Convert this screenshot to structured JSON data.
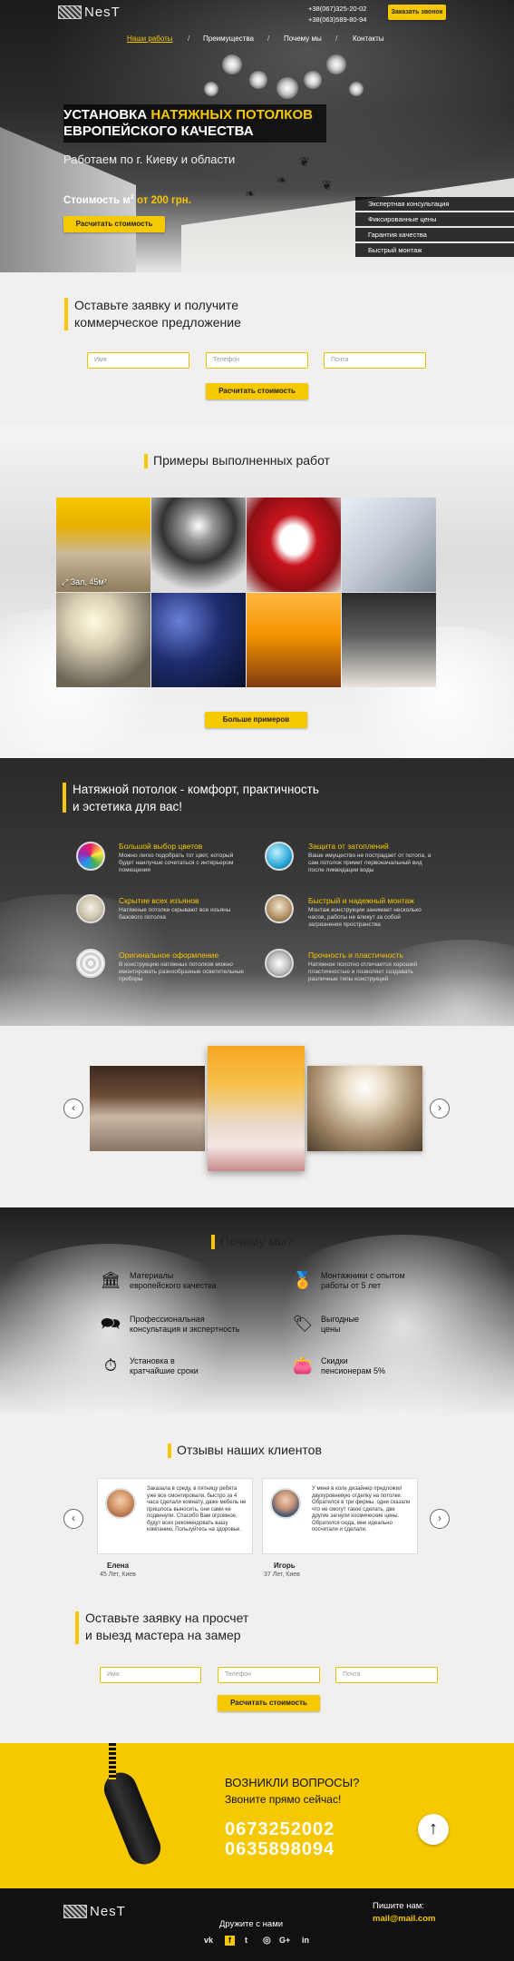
{
  "header": {
    "logo_text": "NesT",
    "phones": [
      "+38(067)325-20-02",
      "+38(063)589-80-94"
    ],
    "call_button": "Заказать звонок",
    "nav": [
      "Наши работы",
      "Преимущества",
      "Почему мы",
      "Контакты"
    ],
    "nav_separator": "/"
  },
  "hero": {
    "title_part1": "УСТАНОВКА ",
    "title_highlight": "НАТЯЖНЫХ ПОТОЛКОВ",
    "title_line2": "ЕВРОПЕЙСКОГО КАЧЕСТВА",
    "subtitle": "Работаем по г. Киеву и области",
    "price_label": "Стоимость м",
    "price_sup": "2",
    "price_value": " от 200 грн.",
    "cta_button": "Расчитать стоимость",
    "features": [
      "Экспертная консультация",
      "Фиксированные цены",
      "Гарантия качества",
      "Быстрый монтаж"
    ]
  },
  "request_form": {
    "heading_line1": "Оставьте заявку и получите",
    "heading_line2": "коммерческое предложение",
    "name_placeholder": "Имя",
    "phone_placeholder": "Телефон",
    "email_placeholder": "Почта",
    "submit": "Расчитать стоимость"
  },
  "works": {
    "heading": "Примеры выполненных работ",
    "first_photo_label": "Зал, 45м²",
    "more_button": "Больше примеров"
  },
  "comfort": {
    "heading_line1": "Натяжной потолок - комфорт, практичность",
    "heading_line2": "и эстетика для вас!",
    "items": [
      {
        "title": "Большой выбор цветов",
        "text": "Можно легко подобрать тот цвет, который будет наилучше сочетаться с интерьером помещения",
        "icon": "color-balls-icon"
      },
      {
        "title": "Защита от затоплений",
        "text": "Ваше имущество не пострадает от потопа, а сам потолок примет первоначальный вид после ликвидации воды",
        "icon": "water-drop-icon"
      },
      {
        "title": "Скрытие всех изъянов",
        "text": "Натяжные потолки скрывают все изъяны базового потолка",
        "icon": "ceiling-flaw-icon"
      },
      {
        "title": "Быстрый и надежный монтаж",
        "text": "Монтаж конструкции занимает несколько часов, работы не влекут за собой загрязнения пространства",
        "icon": "installation-icon"
      },
      {
        "title": "Оригинальное оформление",
        "text": "В конструкцию натяжных потолков можно вмонтировать разнообразные осветительные приборы",
        "icon": "texture-icon"
      },
      {
        "title": "Прочность и пластичность",
        "text": "Натяжное полотно отличается хорошей пластичностью и позволяет создавать различные типы конструкций",
        "icon": "ceiling-structure-icon"
      }
    ]
  },
  "slider": {
    "prev": "‹",
    "next": "›"
  },
  "why": {
    "heading": "Почему мы?",
    "items": [
      {
        "text_line1": "Материалы",
        "text_line2": "европейского качества",
        "icon": "building-icon"
      },
      {
        "text_line1": "Монтажники с опытом",
        "text_line2": "работы от 5 лет",
        "icon": "medal-icon"
      },
      {
        "text_line1": "Профессиональная",
        "text_line2": "консультация и экспертность",
        "icon": "consultant-icon"
      },
      {
        "text_line1": "Выгодные",
        "text_line2": "цены",
        "icon": "price-tag-icon"
      },
      {
        "text_line1": "Установка в",
        "text_line2": "кратчайшие сроки",
        "icon": "stopwatch-icon"
      },
      {
        "text_line1": "Скидки",
        "text_line2": "пенсионерам 5%",
        "icon": "wallet-icon"
      }
    ]
  },
  "reviews": {
    "heading": "Отзывы наших клиентов",
    "items": [
      {
        "text": "Заказала в среду, в пятницу ребята уже все смонтировали, быстро за 4 часа сделали комнату, даже мебель не пришлось выносить, они сами ее подвинули. Спасибо Вам огромное, будут всех рекомендовать вашу компанию. Пользуйтесь на здоровье.",
        "name": "Елена",
        "info": "45 Лет, Киев"
      },
      {
        "text": "У меня в коле дизайнер предложил двухуровневую отделку на потолке. Обратился в три фирмы, одни сказали что не смогут такое сделать, две другие загнули космические цены. Обратился сюда, мне идеально посчитали и сделали.",
        "name": "Игорь",
        "info": "37 Лет, Киев"
      }
    ]
  },
  "request_form2": {
    "heading_line1": "Оставьте заявку на просчет",
    "heading_line2": "и выезд мастера на замер",
    "name_placeholder": "Имя",
    "phone_placeholder": "Телефон",
    "email_placeholder": "Почта",
    "submit": "Расчитать стоимость"
  },
  "questions": {
    "line1": "ВОЗНИКЛИ ВОПРОСЫ?",
    "line2": "Звоните прямо сейчас!",
    "phone1": "0673252002",
    "phone2": "0635898094",
    "scroll_top": "↑"
  },
  "footer": {
    "logo_text": "NesT",
    "friends": "Дружите с нами",
    "write_label": "Пишите нам:",
    "email": "mail@mail.com",
    "socials": [
      "vk",
      "f",
      "t",
      "◎",
      "G+",
      "in"
    ]
  },
  "colors": {
    "accent": "#f5c800",
    "dark": "#111111"
  }
}
